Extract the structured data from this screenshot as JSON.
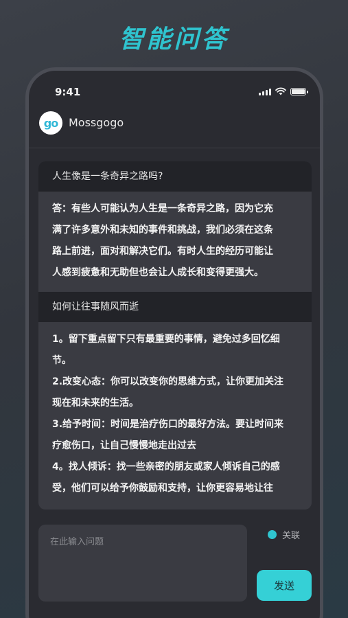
{
  "hero": {
    "title": "智能问答"
  },
  "status_bar": {
    "time": "9:41"
  },
  "app": {
    "name": "Mossgogo",
    "logo_text": "go"
  },
  "chat": [
    {
      "question": "人生像是一条奇异之路吗?",
      "answer_lines": [
        "答：有些人可能认为人生是一条奇异之路，因为它充",
        "满了许多意外和未知的事件和挑战，我们必须在这条",
        "路上前进，面对和解决它们。有时人生的经历可能让",
        "人感到疲惫和无助但也会让人成长和变得更强大。"
      ]
    },
    {
      "question": "如何让往事随风而逝",
      "answer_lines": [
        "1。留下重点留下只有最重要的事情，避免过多回忆细",
        "节。",
        "2.改变心态：你可以改变你的思维方式，让你更加关注",
        "现在和未来的生活。",
        "3.给予时间：时间是治疗伤口的最好方法。要让时间来",
        "疗愈伤口，让自己慢慢地走出过去",
        "4。找人倾诉：找一些亲密的朋友或家人倾诉自己的感",
        "受，他们可以给予你鼓励和支持，让你更容易地让往"
      ]
    }
  ],
  "input": {
    "placeholder": "在此输入问题",
    "value": ""
  },
  "related": {
    "label": "关联"
  },
  "send": {
    "label": "发送"
  },
  "colors": {
    "accent": "#2fc4cf",
    "send_button": "#35d0d6"
  }
}
